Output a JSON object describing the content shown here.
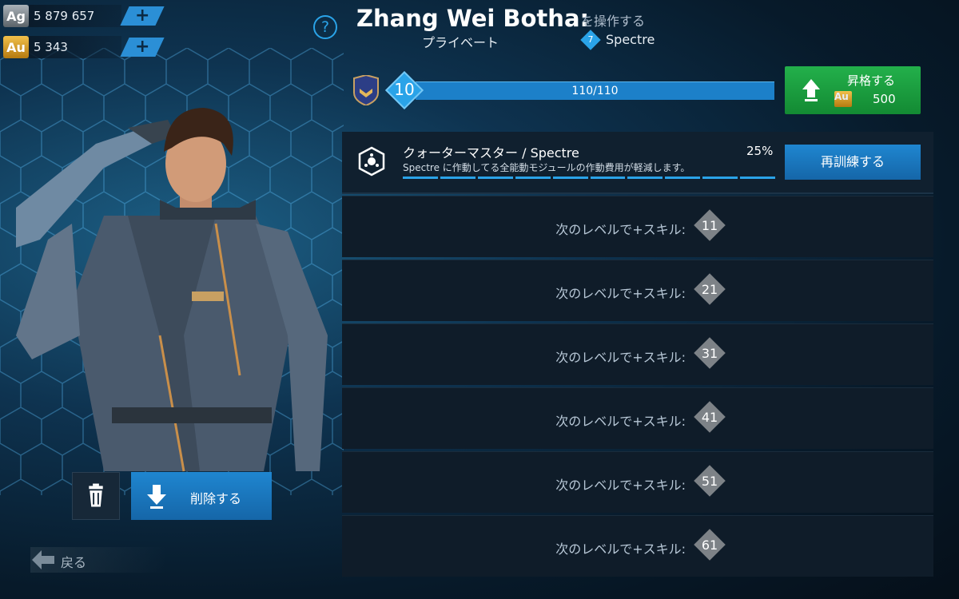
{
  "currency": {
    "silver": {
      "label": "Ag",
      "amount": "5 879 657"
    },
    "gold": {
      "label": "Au",
      "amount": "5 343"
    }
  },
  "header": {
    "help": "?",
    "name": "Zhang Wei Botha:",
    "operate": "を操作する",
    "rank": "プライベート",
    "class_level": "7",
    "class_name": "Spectre"
  },
  "level": {
    "value": "10",
    "xp": "110/110",
    "fill": 1.0
  },
  "promote": {
    "label": "昇格する",
    "currency": "Au",
    "cost": "500"
  },
  "skill": {
    "title": "クォーターマスター / Spectre",
    "description": "Spectre に作動してる全能動モジュールの作動費用が軽減します。",
    "percent": "25%",
    "retrain_label": "再訓練する",
    "segments_total": 10,
    "segments_filled": 10
  },
  "unlocks": [
    {
      "label": "次のレベルで+スキル:",
      "level": "11"
    },
    {
      "label": "次のレベルで+スキル:",
      "level": "21"
    },
    {
      "label": "次のレベルで+スキル:",
      "level": "31"
    },
    {
      "label": "次のレベルで+スキル:",
      "level": "41"
    },
    {
      "label": "次のレベルで+スキル:",
      "level": "51"
    },
    {
      "label": "次のレベルで+スキル:",
      "level": "61"
    }
  ],
  "actions": {
    "delete_label": "削除する",
    "back_label": "戻る"
  },
  "colors": {
    "accent": "#2aa3e8",
    "promote": "#1ea243",
    "panel": "#0f1c29"
  }
}
